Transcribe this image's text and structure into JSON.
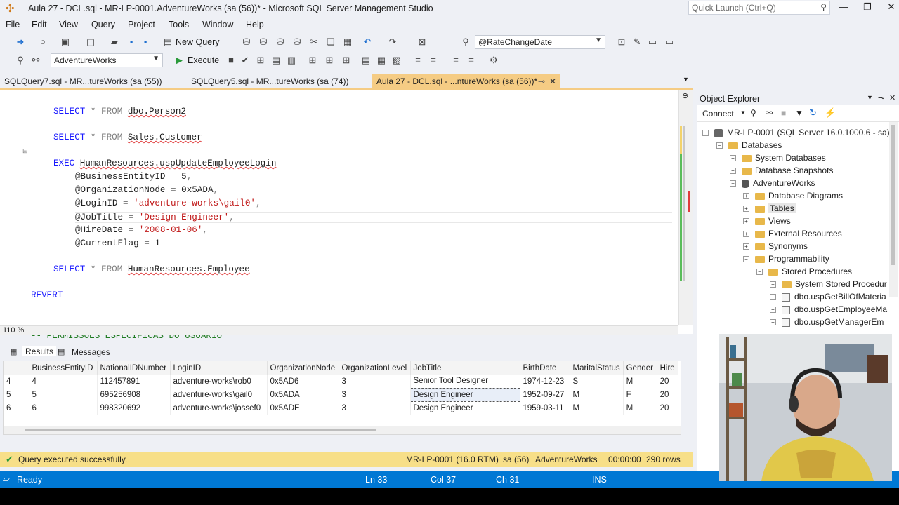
{
  "window": {
    "title": "Aula 27 - DCL.sql - MR-LP-0001.AdventureWorks (sa (56))* - Microsoft SQL Server Management Studio",
    "quick_launch_placeholder": "Quick Launch (Ctrl+Q)"
  },
  "menu": [
    "File",
    "Edit",
    "View",
    "Query",
    "Project",
    "Tools",
    "Window",
    "Help"
  ],
  "toolbar": {
    "new_query_label": "New Query",
    "param_combo_value": "@RateChangeDate",
    "database_combo_value": "AdventureWorks",
    "execute_label": "Execute"
  },
  "tabs": [
    {
      "label": "SQLQuery7.sql - MR...tureWorks (sa (55))"
    },
    {
      "label": "SQLQuery5.sql - MR...tureWorks (sa (74))"
    },
    {
      "label": "Aula 27 - DCL.sql - ...ntureWorks (sa (56))*"
    }
  ],
  "editor": {
    "zoom": "110 %",
    "lines": {
      "l1_kw": "SELECT",
      "l1_rest": " * FROM ",
      "l1_obj": "dbo.Person2",
      "l2_kw": "SELECT",
      "l2_rest": " * FROM ",
      "l2_obj": "Sales.Customer",
      "l3_kw": "EXEC",
      "l3_obj": "HumanResources.uspUpdateEmployeeLogin",
      "p1": "@BusinessEntityID",
      "p1v": "5",
      "p2": "@OrganizationNode",
      "p2v": "0x5ADA",
      "p3": "@LoginID",
      "p3v": "'adventure-works\\gail0'",
      "p4": "@JobTitle",
      "p4v": "'Design Engineer'",
      "p5": "@HireDate",
      "p5v": "'2008-01-06'",
      "p6": "@CurrentFlag",
      "p6v": "1",
      "l4_kw": "SELECT",
      "l4_rest": " * FROM ",
      "l4_obj": "HumanResources.Employee",
      "revert": "REVERT",
      "comment": "-- PERMISSÕES ESPECÍFICAS DO USUÁRIO"
    }
  },
  "results": {
    "tab_results": "Results",
    "tab_messages": "Messages",
    "columns": [
      "BusinessEntityID",
      "NationalIDNumber",
      "LoginID",
      "OrganizationNode",
      "OrganizationLevel",
      "JobTitle",
      "BirthDate",
      "MaritalStatus",
      "Gender",
      "Hire"
    ],
    "rows": [
      {
        "n": "4",
        "cells": [
          "4",
          "112457891",
          "adventure-works\\rob0",
          "0x5AD6",
          "3",
          "Senior Tool Designer",
          "1974-12-23",
          "S",
          "M",
          "20"
        ]
      },
      {
        "n": "5",
        "cells": [
          "5",
          "695256908",
          "adventure-works\\gail0",
          "0x5ADA",
          "3",
          "Design Engineer",
          "1952-09-27",
          "M",
          "F",
          "20"
        ]
      },
      {
        "n": "6",
        "cells": [
          "6",
          "998320692",
          "adventure-works\\jossef0",
          "0x5ADE",
          "3",
          "Design Engineer",
          "1959-03-11",
          "M",
          "M",
          "20"
        ]
      }
    ]
  },
  "query_status": {
    "message": "Query executed successfully.",
    "server": "MR-LP-0001 (16.0 RTM)",
    "user": "sa (56)",
    "database": "AdventureWorks",
    "elapsed": "00:00:00",
    "rows": "290 rows"
  },
  "statusbar": {
    "state": "Ready",
    "ln": "Ln 33",
    "col": "Col 37",
    "ch": "Ch 31",
    "mode": "INS"
  },
  "object_explorer": {
    "title": "Object Explorer",
    "connect_label": "Connect",
    "nodes": [
      {
        "label": "MR-LP-0001 (SQL Server 16.0.1000.6 - sa)"
      },
      {
        "label": "Databases"
      },
      {
        "label": "System Databases"
      },
      {
        "label": "Database Snapshots"
      },
      {
        "label": "AdventureWorks"
      },
      {
        "label": "Database Diagrams"
      },
      {
        "label": "Tables"
      },
      {
        "label": "Views"
      },
      {
        "label": "External Resources"
      },
      {
        "label": "Synonyms"
      },
      {
        "label": "Programmability"
      },
      {
        "label": "Stored Procedures"
      },
      {
        "label": "System Stored Procedur"
      },
      {
        "label": "dbo.uspGetBillOfMateria"
      },
      {
        "label": "dbo.uspGetEmployeeMa"
      },
      {
        "label": "dbo.uspGetManagerEm"
      }
    ]
  },
  "colors": {
    "accent_tab": "#f5cc84",
    "statusbar": "#0078d4",
    "query_status_bg": "#f7df88",
    "keyword": "#1a1aff",
    "string": "#c01818",
    "comment": "#1f7a1f"
  }
}
